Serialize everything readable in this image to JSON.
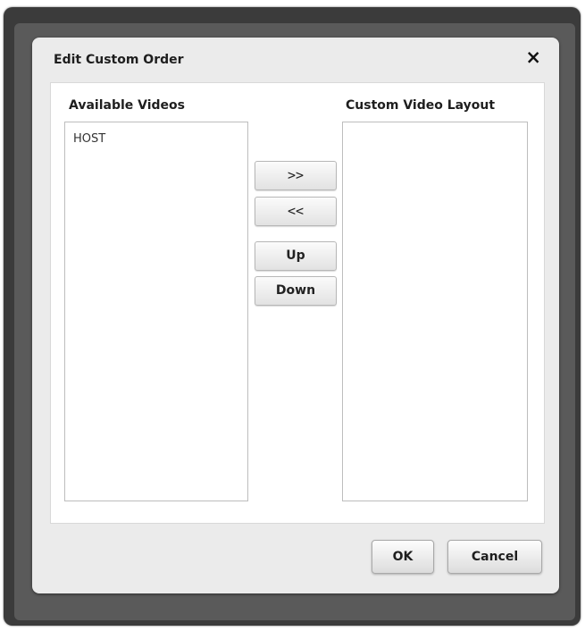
{
  "dialog": {
    "title": "Edit Custom Order",
    "close_icon": "×",
    "ok_label": "OK",
    "cancel_label": "Cancel"
  },
  "available": {
    "label": "Available Videos",
    "items": [
      "HOST"
    ]
  },
  "custom": {
    "label": "Custom Video Layout",
    "items": []
  },
  "controls": {
    "add_label": ">>",
    "remove_label": "<<",
    "up_label": "Up",
    "down_label": "Down"
  }
}
